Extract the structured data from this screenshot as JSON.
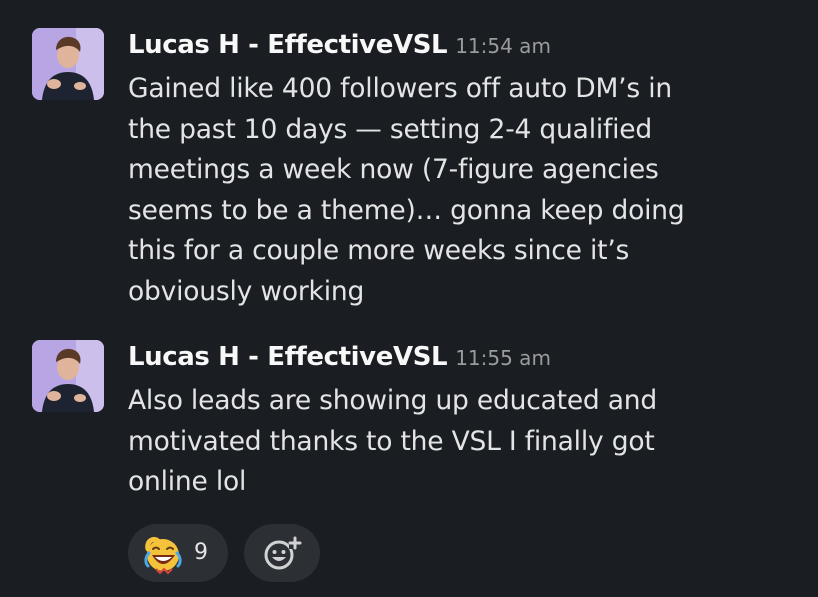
{
  "messages": [
    {
      "sender": "Lucas H - EffectiveVSL",
      "timestamp": "11:54 am",
      "lines": [
        "Gained like 400 followers off auto DM’s in",
        "the past 10 days — setting 2-4 qualified",
        "meetings a week now (7-figure agencies",
        "seems to be a theme)… gonna keep doing",
        "this for a couple more weeks since it’s",
        "obviously working"
      ]
    },
    {
      "sender": "Lucas H - EffectiveVSL",
      "timestamp": "11:55 am",
      "lines": [
        "Also leads are showing up educated and",
        "motivated thanks to the VSL I finally got",
        "online lol"
      ]
    }
  ],
  "reactions": [
    {
      "emoji": "laughing-crying-face-icon",
      "count": "9"
    }
  ],
  "add_reaction": {
    "icon": "add-emoji-icon"
  },
  "colors": {
    "background": "#1a1d21",
    "reaction_pill": "#2c2f33",
    "sender": "#f8f8f8",
    "text": "#e3e4e5",
    "timestamp": "#9a9b9d"
  }
}
